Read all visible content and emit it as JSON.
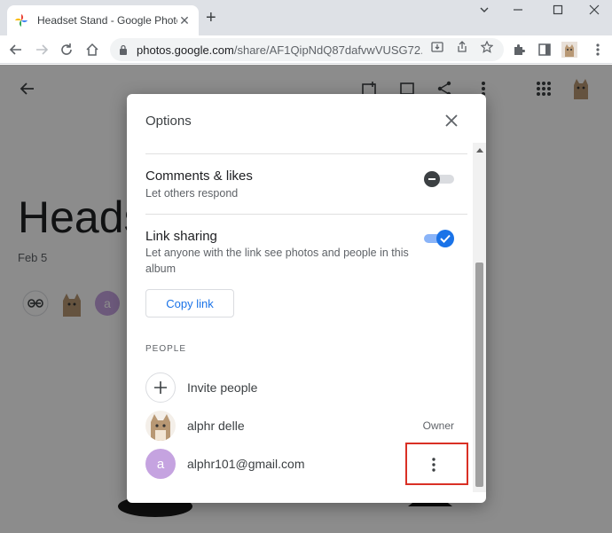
{
  "browser": {
    "tab_title": "Headset Stand - Google Photos",
    "tab_close": "✕",
    "new_tab": "+",
    "url_host": "photos.google.com",
    "url_path": "/share/AF1QipNdQ87dafvwVUSG72...",
    "window_controls": {
      "minimize": "—",
      "maximize": "☐",
      "close": "✕"
    },
    "back": "←",
    "forward": "→",
    "reload": "↻"
  },
  "page": {
    "album_title": "Heads",
    "album_date": "Feb 5"
  },
  "dialog": {
    "title": "Options",
    "comments": {
      "title": "Comments & likes",
      "subtitle": "Let others respond",
      "enabled": false
    },
    "link_sharing": {
      "title": "Link sharing",
      "subtitle": "Let anyone with the link see photos and people in this album",
      "enabled": true
    },
    "copy_link_label": "Copy link",
    "people_section_label": "PEOPLE",
    "invite_label": "Invite people",
    "people": [
      {
        "name": "alphr delle",
        "role": "Owner"
      },
      {
        "name": "alphr101@gmail.com",
        "avatar_letter": "a"
      }
    ]
  },
  "colors": {
    "accent": "#1a73e8",
    "highlight_box": "#d93025",
    "letter_avatar": "#c5a3e0"
  }
}
